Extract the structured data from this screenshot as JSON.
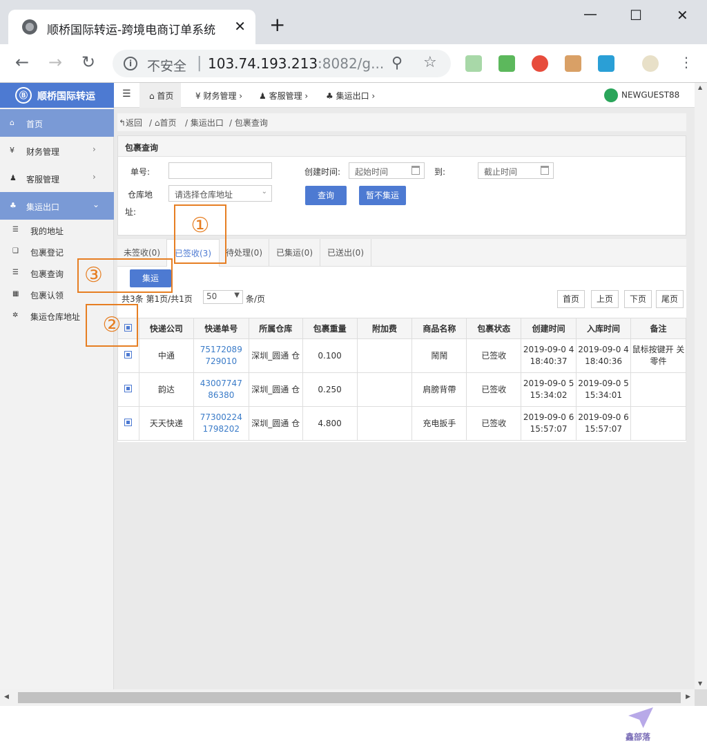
{
  "browser": {
    "tab_title": "顺桥国际转运-跨境电商订单系统",
    "tab_close": "✕",
    "new_tab": "+",
    "window_controls": [
      "—",
      "☐",
      "✕"
    ],
    "security_label": "不安全",
    "url_host": "103.74.193.213",
    "url_rest": ":8082/g...",
    "separator": "|",
    "icons": [
      "back-icon",
      "forward-icon",
      "reload-icon",
      "info-icon",
      "zoom-icon",
      "star-icon",
      "menu-icon"
    ]
  },
  "app": {
    "logo_text": "顺桥国际转运",
    "logo_mark": "Ⓑ",
    "sidebar": [
      {
        "icon": "⌂",
        "label": "首页",
        "arrow": ""
      },
      {
        "icon": "¥",
        "label": "财务管理",
        "arrow": "›"
      },
      {
        "icon": "♟",
        "label": "客服管理",
        "arrow": "›"
      },
      {
        "icon": "♣",
        "label": "集运出口",
        "arrow": "⌄"
      }
    ],
    "submenu": [
      {
        "icon": "☰",
        "label": "我的地址"
      },
      {
        "icon": "❑",
        "label": "包裹登记"
      },
      {
        "icon": "☰",
        "label": "包裹查询"
      },
      {
        "icon": "▦",
        "label": "包裹认领"
      },
      {
        "icon": "✲",
        "label": "集运仓库地址"
      }
    ],
    "topnav": {
      "menu_toggle": "☰",
      "home": "⌂ 首页",
      "finance": "¥ 财务管理 ›",
      "service": "♟ 客服管理 ›",
      "export": "♣ 集运出口 ›",
      "user": "NEWGUEST88"
    },
    "breadcrumb": [
      "↰返回",
      "/ ⌂首页",
      "/ 集运出口",
      "/ 包裹查询"
    ],
    "panel": {
      "title": "包裹查询",
      "order_label": "单号:",
      "order_value": "",
      "created_label": "创建时间:",
      "start_placeholder": "起始时间",
      "to_label": "到:",
      "end_placeholder": "截止时间",
      "warehouse_label_1": "仓库地",
      "warehouse_label_2": "址:",
      "warehouse_select": "请选择仓库地址",
      "search_btn": "查询",
      "hold_btn": "暂不集运"
    },
    "tabs": [
      "未签收(0)",
      "已签收(3)",
      "待处理(0)",
      "已集运(0)",
      "已送出(0)"
    ],
    "consolidate_btn": "集运",
    "pagination": {
      "summary": "共3条  第1页/共1页",
      "page_size": "50",
      "per_page": "条/页",
      "buttons": [
        "首页",
        "上页",
        "下页",
        "尾页"
      ]
    },
    "table": {
      "headers": [
        "",
        "快递公司",
        "快递单号",
        "所属仓库",
        "包裹重量",
        "附加费",
        "商品名称",
        "包裹状态",
        "创建时间",
        "入库时间",
        "备注"
      ],
      "rows": [
        [
          "",
          "中通",
          "75172089 729010",
          "深圳_圆通 仓",
          "0.100",
          "",
          "鬧鬧",
          "已签收",
          "2019-09-0 4 18:40:37",
          "2019-09-0 4 18:40:36",
          "鼠标按键开 关零件"
        ],
        [
          "",
          "韵达",
          "43007747 86380",
          "深圳_圆通 仓",
          "0.250",
          "",
          "肩膀背帶",
          "已签收",
          "2019-09-0 5 15:34:02",
          "2019-09-0 5 15:34:01",
          ""
        ],
        [
          "",
          "天天快递",
          "77300224 1798202",
          "深圳_圆通 仓",
          "4.800",
          "",
          "充电扳手",
          "已签收",
          "2019-09-0 6 15:57:07",
          "2019-09-0 6 15:57:07",
          ""
        ]
      ]
    },
    "annotations": [
      "①",
      "②",
      "③"
    ],
    "watermark": "鑫部落"
  },
  "colors": {
    "primary": "#4d7ad2",
    "annotation": "#e67e22",
    "link": "#3a7bc8",
    "user_avatar": "#2aa55a"
  }
}
